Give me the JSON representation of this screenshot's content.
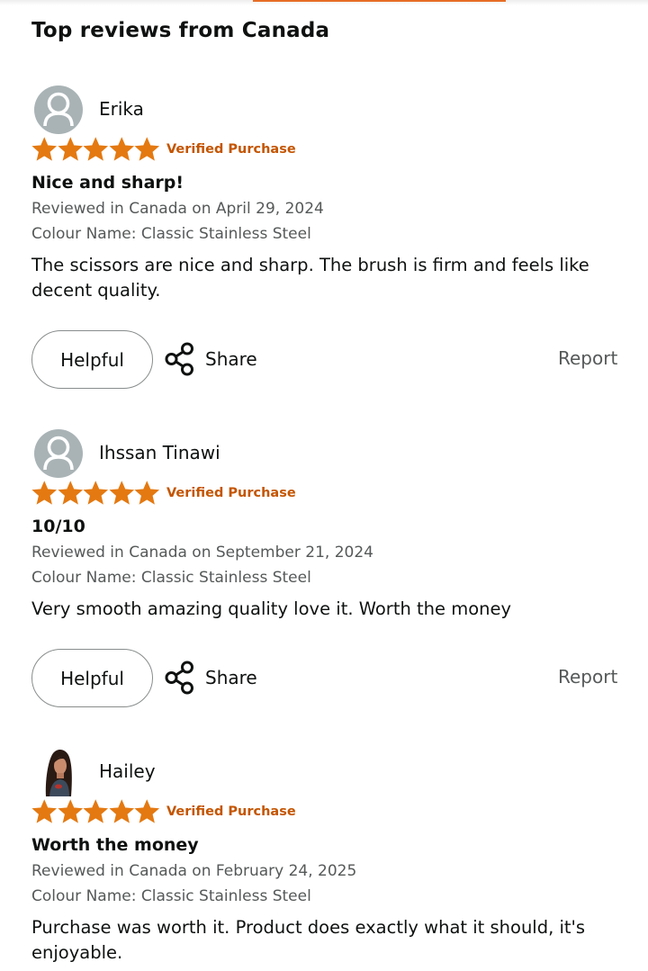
{
  "colors": {
    "star": "#e47911",
    "verified": "#c45500",
    "accent": "#e76e26",
    "avatar_bg": "#a9b3b5"
  },
  "section": {
    "title": "Top reviews from Canada"
  },
  "reviews": [
    {
      "name": "Erika",
      "avatar": "default-profile-icon",
      "rating": 5,
      "verified": "Verified Purchase",
      "title": "Nice and sharp!",
      "date": "Reviewed in Canada on April 29, 2024",
      "colour": "Colour Name: Classic Stainless Steel",
      "body": "The scissors are nice and sharp. The brush is firm and feels like decent quality.",
      "helpful": "Helpful",
      "share": "Share",
      "report": "Report"
    },
    {
      "name": "Ihssan Tinawi",
      "avatar": "default-profile-icon",
      "rating": 5,
      "verified": "Verified Purchase",
      "title": "10/10",
      "date": "Reviewed in Canada on September 21, 2024",
      "colour": "Colour Name: Classic Stainless Steel",
      "body": "Very smooth amazing quality love it. Worth the money",
      "helpful": "Helpful",
      "share": "Share",
      "report": "Report"
    },
    {
      "name": "Hailey",
      "avatar": "user-photo",
      "rating": 5,
      "verified": "Verified Purchase",
      "title": "Worth the money",
      "date": "Reviewed in Canada on February 24, 2025",
      "colour": "Colour Name: Classic Stainless Steel",
      "body": "Purchase was worth it. Product does exactly what it should, it's enjoyable."
    }
  ]
}
